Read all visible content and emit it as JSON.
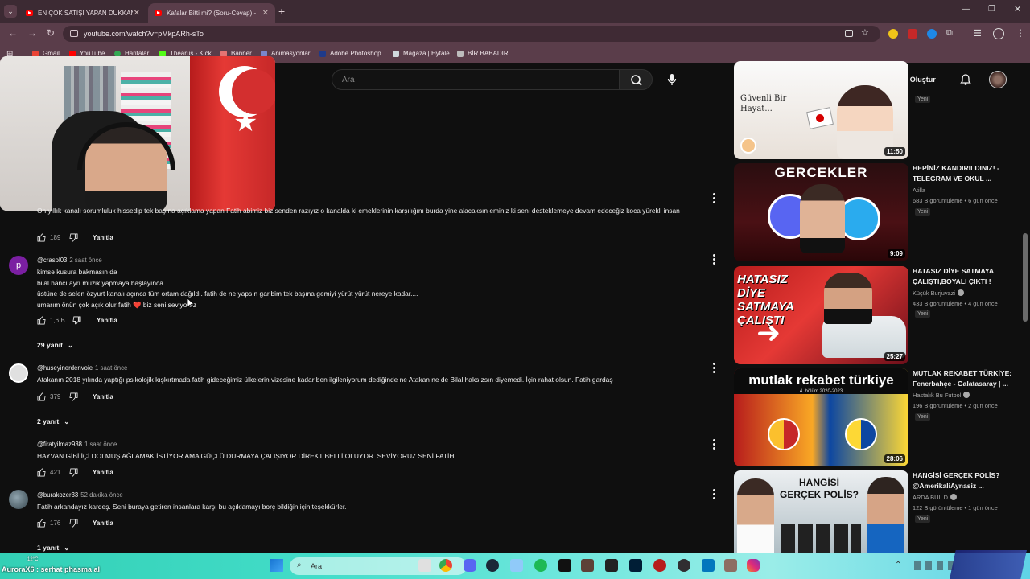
{
  "browser": {
    "tabs": [
      {
        "title": "EN ÇOK SATIŞI YAPAN DÜKKAN"
      },
      {
        "title": "Kafalar Bitti mi? (Soru-Cevap) -"
      }
    ],
    "url": "youtube.com/watch?v=pMkpARh-sTo",
    "bookmarks": [
      "Gmail",
      "YouTube",
      "Haritalar",
      "Thearus - Kick",
      "Banner",
      "Animasyonlar",
      "Adobe Photoshop",
      "Mağaza | Hytale",
      "BİR BABADIR"
    ]
  },
  "youtube": {
    "search_placeholder": "Ara",
    "create_label": "Oluştur"
  },
  "comments": [
    {
      "text": "On yıllık kanalı sorumluluk hissedip tek başına açıklama yapan Fatih abimiz biz senden razıyız o kanalda ki emeklerinin karşılığını burda yine alacaksın eminiz ki seni desteklemeye devam edeceğiz koca yürekli insan",
      "likes": "189",
      "reply": "Yanıtla"
    },
    {
      "author": "@crasol03",
      "time": "2 saat önce",
      "lines": [
        "kimse kusura bakmasın da",
        "bilal hancı ayrı müzik yapmaya başlayınca",
        "üstüne de selen özyurt kanalı açınca tüm ortam dağıldı. fatih de ne yapsın garibim tek başına gemiyi yürüt yürüt nereye kadar....",
        "umarım önün çok açık olur fatih ❤️ biz seni seviyoruz"
      ],
      "likes": "1,6 B",
      "reply": "Yanıtla",
      "replies": "29 yanıt",
      "avatar_letter": "p",
      "avatar_color": "#7b1fa2"
    },
    {
      "author": "@huseyinerdenvoie",
      "time": "1 saat önce",
      "text": "Atakanın 2018 yılında yaptığı psikolojik kışkırtmada fatih gideceğimiz ülkelerin vizesine kadar ben ilgileniyorum dediğinde ne Atakan ne de Bilal haksızsın diyemedi. İçin rahat olsun. Fatih gardaş",
      "likes": "379",
      "reply": "Yanıtla",
      "replies": "2 yanıt"
    },
    {
      "author": "@firatyilmaz938",
      "time": "1 saat önce",
      "text": "HAYVAN GİBİ İÇİ DOLMUŞ AĞLAMAK İSTİYOR AMA GÜÇLÜ DURMAYA ÇALIŞIYOR DİREKT BELLİ OLUYOR. SEVİYORUZ SENİ FATİH",
      "likes": "421",
      "reply": "Yanıtla"
    },
    {
      "author": "@burakozer33",
      "time": "52 dakika önce",
      "text": "Fatih arkandayız kardeş. Seni buraya getiren insanlara karşı bu açıklamayı borç bildiğin için teşekkürler.",
      "likes": "176",
      "reply": "Yanıtla",
      "replies": "1 yanıt"
    }
  ],
  "sidebar": [
    {
      "thumb_text": "Güvenli Bir Hayat...",
      "duration": "11:50",
      "new": "Yeni"
    },
    {
      "title": "HEPİNİZ KANDIRILDINIZ! - TELEGRAM VE OKUL ...",
      "channel": "Atilla",
      "stats": "683 B görüntüleme • 6 gün önce",
      "new": "Yeni",
      "thumb_text": "GERCEKLER",
      "duration": "9:09"
    },
    {
      "title": "HATASIZ DİYE SATMAYA ÇALIŞTI,BOYALI ÇIKTI !",
      "channel": "Küçük Burjuvazi",
      "stats": "433 B görüntüleme • 4 gün önce",
      "new": "Yeni",
      "thumb_text": "HATASIZ DİYE SATMAYA ÇALIŞTI",
      "duration": "25:27"
    },
    {
      "title": "MUTLAK REKABET TÜRKİYE: Fenerbahçe - Galatasaray | ...",
      "channel": "Hastalık Bu Futbol",
      "stats": "196 B görüntüleme • 2 gün önce",
      "new": "Yeni",
      "thumb_text": "mutlak rekabet türkiye",
      "thumb_sub": "4. bölüm 2020-2023",
      "duration": "28:06"
    },
    {
      "title": "HANGİSİ GERÇEK POLİS? @AmerikaliAynasiz ...",
      "channel": "ARDA BUILD",
      "stats": "122 B görüntüleme • 1 gün önce",
      "new": "Yeni",
      "thumb_text": "HANGİSİ GERÇEK POLİS?"
    }
  ],
  "taskbar": {
    "search": "Ara",
    "temp": "12°C",
    "marquee": "AuroraX6 : serhat phasma al"
  }
}
